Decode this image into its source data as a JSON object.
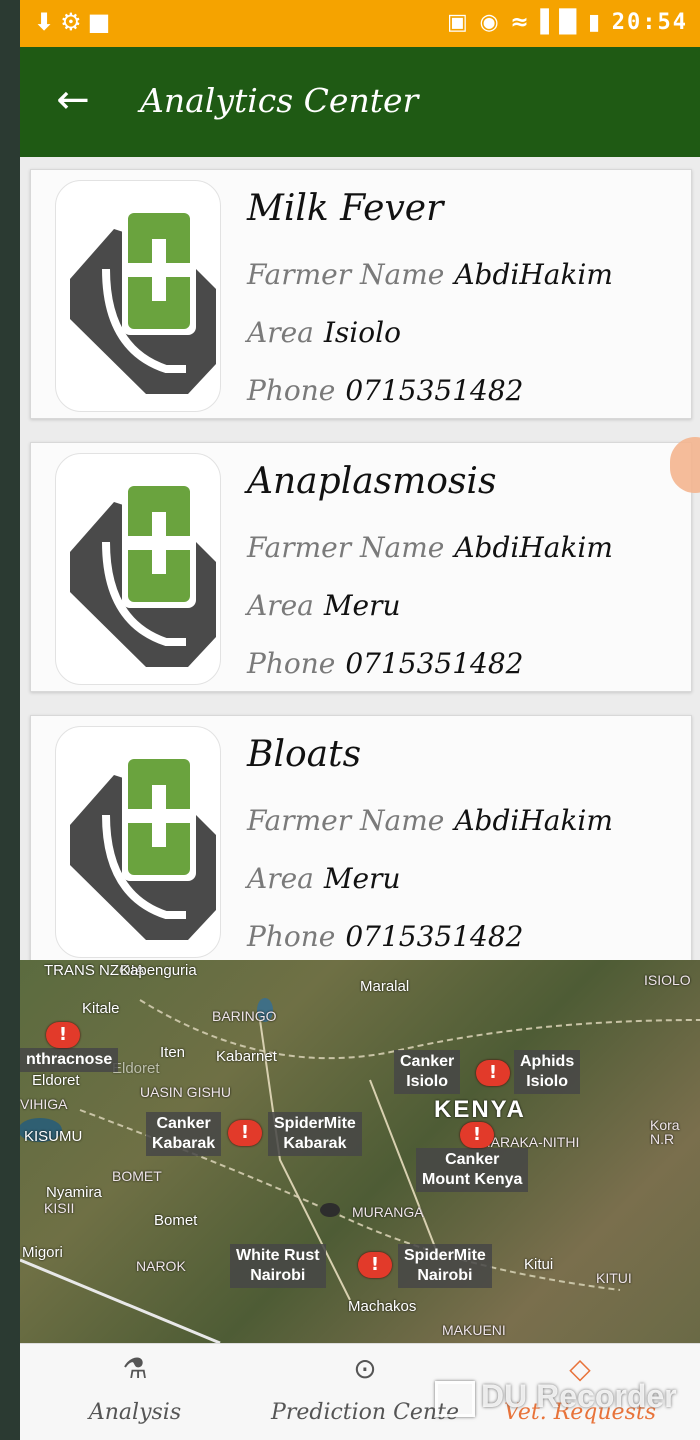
{
  "status_bar": {
    "time": "20:54"
  },
  "app_bar": {
    "title": "Analytics Center"
  },
  "cards": [
    {
      "disease": "Milk Fever",
      "farmer_label": "Farmer Name",
      "farmer": "AbdiHakim",
      "area_label": "Area",
      "area": "Isiolo",
      "phone_label": "Phone",
      "phone": "0715351482"
    },
    {
      "disease": "Anaplasmosis",
      "farmer_label": "Farmer Name",
      "farmer": "AbdiHakim",
      "area_label": "Area",
      "area": "Meru",
      "phone_label": "Phone",
      "phone": "0715351482"
    },
    {
      "disease": "Bloats",
      "farmer_label": "Farmer Name",
      "farmer": "AbdiHakim",
      "area_label": "Area",
      "area": "Meru",
      "phone_label": "Phone",
      "phone": "0715351482"
    }
  ],
  "map": {
    "places": [
      "TRANS NZOIA",
      "Kapenguria",
      "Kitale",
      "Maralal",
      "ISIOLO",
      "BARINGO",
      "Iten",
      "Kabarnet",
      "Eldoret",
      "UASIN GISHU",
      "VIHIGA",
      "KISUMU",
      "BOMET",
      "Nyamira",
      "KISII",
      "Bomet",
      "Migori",
      "NAROK",
      "MURANGA",
      "Kitui",
      "KITUI",
      "Machakos",
      "MAKUENI",
      "Kora N.R",
      "THARAKA-NITHI",
      "Eldoret"
    ],
    "country": "KENYA",
    "callouts": [
      {
        "disease": "nthracnose",
        "area": "Eldoret"
      },
      {
        "disease": "Canker",
        "area": "Kabarak"
      },
      {
        "disease": "SpiderMite",
        "area": "Kabarak"
      },
      {
        "disease": "Canker",
        "area": "Isiolo"
      },
      {
        "disease": "Aphids",
        "area": "Isiolo"
      },
      {
        "disease": "Canker",
        "area": "Mount Kenya"
      },
      {
        "disease": "White Rust",
        "area": "Nairobi"
      },
      {
        "disease": "SpiderMite",
        "area": "Nairobi"
      }
    ],
    "marker_glyph": "!"
  },
  "bottom_nav": [
    {
      "label": "Analysis",
      "icon": "flask-icon"
    },
    {
      "label": "Prediction Cente",
      "icon": "lightbulb-icon"
    },
    {
      "label": "Vet. Requests",
      "icon": "diamond-icon"
    }
  ],
  "watermark": "DU Recorder",
  "colors": {
    "status_bar": "#f5a300",
    "app_bar": "#1f5a14",
    "marker": "#e23a2a",
    "icon_green": "#6aa33e"
  }
}
